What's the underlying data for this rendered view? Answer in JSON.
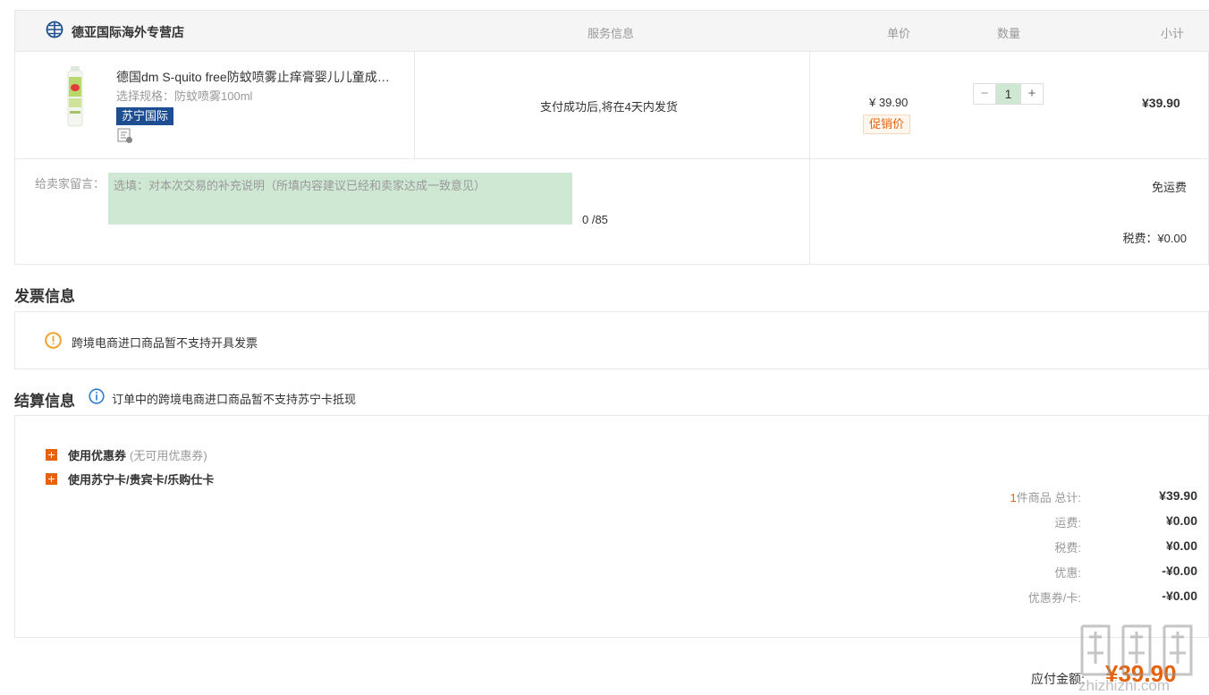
{
  "order": {
    "store_name": "德亚国际海外专营店",
    "columns": {
      "service": "服务信息",
      "unit_price": "单价",
      "quantity": "数量",
      "subtotal": "小计"
    },
    "item": {
      "title": "德国dm S-quito free防蚊喷雾止痒膏婴儿儿童成人驱蚊液",
      "spec": "选择规格：防蚊喷雾100ml",
      "badge": "苏宁国际",
      "service_text": "支付成功后,将在4天内发货",
      "unit_price": "¥ 39.90",
      "promo_label": "促销价",
      "quantity": "1",
      "qty_minus": "−",
      "qty_plus": "+",
      "subtotal": "¥39.90"
    },
    "message": {
      "label": "给卖家留言：",
      "placeholder": "选填：对本次交易的补充说明（所填内容建议已经和卖家达成一致意见）",
      "counter": "0 /85"
    },
    "shipping": "免运费",
    "tax": "税费：¥0.00"
  },
  "invoice": {
    "title": "发票信息",
    "notice": "跨境电商进口商品暂不支持开具发票"
  },
  "settlement": {
    "title": "结算信息",
    "note": "订单中的跨境电商进口商品暂不支持苏宁卡抵现",
    "coupon_label": "使用优惠券",
    "coupon_note": "(无可用优惠券)",
    "card_label": "使用苏宁卡/贵宾卡/乐购仕卡",
    "summary": {
      "item_count": "1",
      "total_label": "件商品 总计:",
      "total_value": "¥39.90",
      "shipping_label": "运费:",
      "shipping_value": "¥0.00",
      "tax_label": "税费:",
      "tax_value": "¥0.00",
      "discount_label": "优惠:",
      "discount_value": "-¥0.00",
      "coupon_card_label": "优惠券/卡:",
      "coupon_card_value": "-¥0.00"
    },
    "payable_label": "应付金额:",
    "payable_value": "¥39.90"
  },
  "watermark": {
    "text": "zhizhizhi.com"
  },
  "colors": {
    "accent": "#e7620c",
    "brand_blue": "#1d4e91",
    "input_bg": "#cfe8d4",
    "border": "#e8e8e8"
  }
}
